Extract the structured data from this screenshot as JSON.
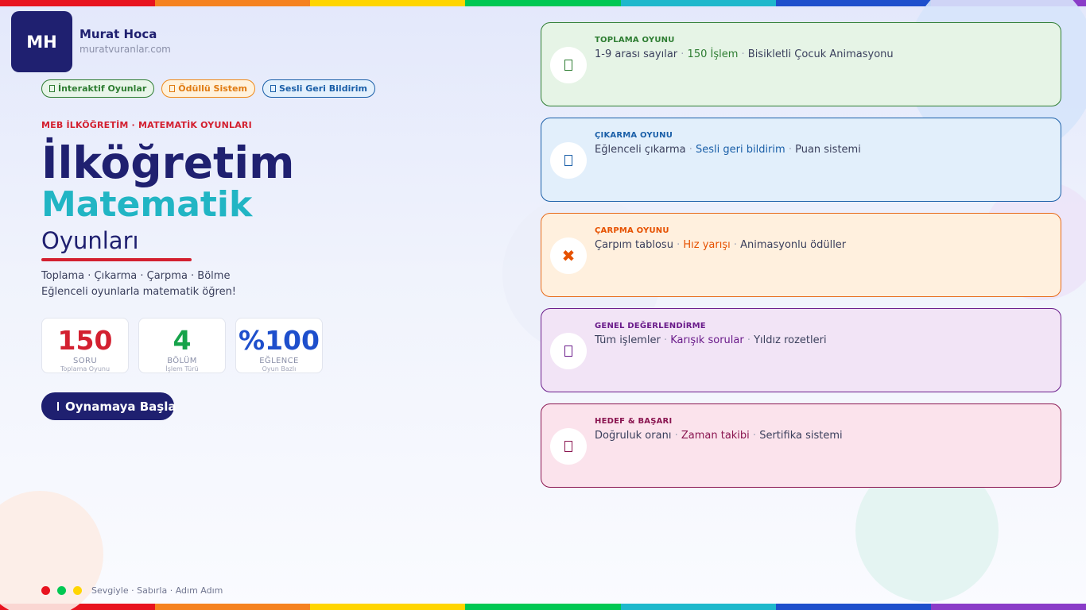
{
  "colors": {
    "navy": "#1f2070",
    "teal": "#21b5c4",
    "red": "#d32030",
    "rainbow": [
      "#e8131f",
      "#f58220",
      "#ffd500",
      "#00c853",
      "#1eb8cc",
      "#1e4fcc",
      "#8a3cc8"
    ]
  },
  "brand": {
    "initials": "MH",
    "name": "Murat Hoca",
    "site": "muratvuranlar.com"
  },
  "tags": [
    {
      "icon": "gamepad-icon",
      "label": "İnteraktif Oyunlar"
    },
    {
      "icon": "trophy-icon",
      "label": "Ödüllü Sistem"
    },
    {
      "icon": "speaker-icon",
      "label": "Sesli Geri Bildirim"
    }
  ],
  "hero": {
    "kicker": "MEB İLKÖĞRETİM · MATEMATİK OYUNLARI",
    "title_line1": "İlköğretim",
    "title_line2": "Matematik",
    "title_line3": "Oyunları",
    "desc_line1": "Toplama · Çıkarma · Çarpma · Bölme",
    "desc_line2": "Eğlenceli oyunlarla matematik öğren!"
  },
  "stats": [
    {
      "value": "150",
      "label": "SORU",
      "sub": "Toplama Oyunu",
      "color": "#d32030"
    },
    {
      "value": "4",
      "label": "BÖLÜM",
      "sub": "İşlem Türü",
      "color": "#16a34a"
    },
    {
      "value": "%100",
      "label": "EĞLENCE",
      "sub": "Oyun Bazlı",
      "color": "#1e4fcc"
    }
  ],
  "cta": {
    "icon": "play-icon",
    "label": "Oynamaya Başla"
  },
  "footer": {
    "dots": [
      "#e8131f",
      "#00c853",
      "#ffd500"
    ],
    "text": "Sevgiyle · Sabırla · Adım Adım"
  },
  "cards": [
    {
      "icon": "plus-icon",
      "glyph": "",
      "title": "TOPLAMA OYUNU",
      "parts": [
        "1-9 arası sayılar",
        "150 İşlem",
        "Bisikletli Çocuk Animasyonu"
      ],
      "accent": "#2e7d32",
      "border": "#2e7d32",
      "bg": "#e6f4e6"
    },
    {
      "icon": "minus-icon",
      "glyph": "",
      "title": "ÇIKARMA OYUNU",
      "parts": [
        "Eğlenceli çıkarma",
        "Sesli geri bildirim",
        "Puan sistemi"
      ],
      "accent": "#1a5fa8",
      "border": "#1a5fa8",
      "bg": "#e2effb"
    },
    {
      "icon": "multiply-icon",
      "glyph": "✖",
      "title": "ÇARPMA OYUNU",
      "parts": [
        "Çarpım tablosu",
        "Hız yarışı",
        "Animasyonlu ödüller"
      ],
      "accent": "#e65100",
      "border": "#e66a1a",
      "bg": "#fff0de"
    },
    {
      "icon": "star-icon",
      "glyph": "",
      "title": "GENEL DEĞERLENDİRME",
      "parts": [
        "Tüm işlemler ",
        "Karışık sorular",
        "Yıldız rozetleri"
      ],
      "accent": "#6a1b8a",
      "border": "#6a1b8a",
      "bg": "#f2e4f6"
    },
    {
      "icon": "target-icon",
      "glyph": "",
      "title": "HEDEF & BAŞARI",
      "parts": [
        "Doğruluk oranı",
        "Zaman takibi",
        "Sertifika sistemi"
      ],
      "accent": "#8a1550",
      "border": "#8a1550",
      "bg": "#fbe3ec"
    }
  ]
}
